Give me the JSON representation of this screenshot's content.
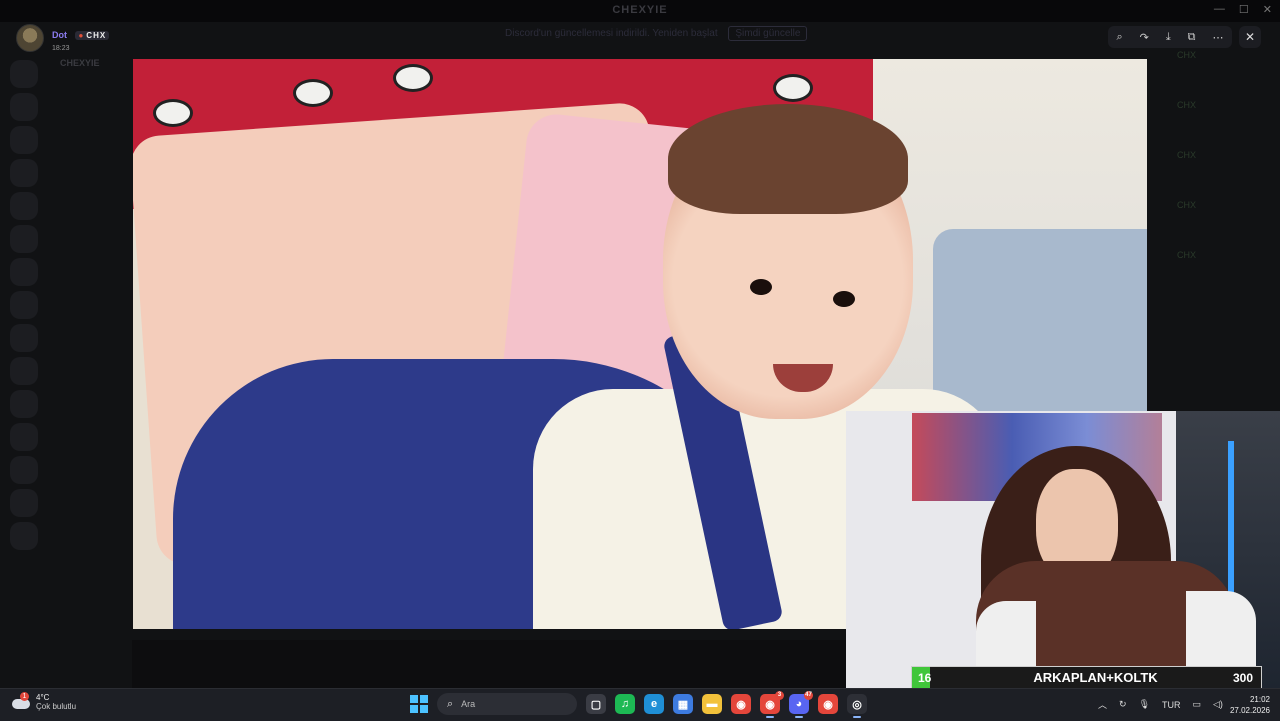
{
  "background_app": {
    "title": "CHEXYIE",
    "notice": "Discord'un güncellemesi indirildi. Yeniden başlat",
    "notice_button": "Şimdi güncelle",
    "server_name": "CHEXYIE",
    "right_tags": [
      "CHX",
      "CHX",
      "CHX",
      "CHX",
      "CHX"
    ]
  },
  "overlay": {
    "username": "Dot",
    "tag": "CHX",
    "time": "18:23",
    "tools": [
      "zoom-icon",
      "forward-icon",
      "download-icon",
      "open-external-icon",
      "more-icon"
    ]
  },
  "stream_goal": {
    "current": "16",
    "label": "ARKAPLAN+KOLTK",
    "max": "300",
    "progress": 0.053,
    "fill_color": "#40c63a"
  },
  "taskbar": {
    "weather_temp": "4°C",
    "weather_desc": "Çok bulutlu",
    "weather_badge": "1",
    "search_placeholder": "Ara",
    "apps": [
      {
        "name": "task-view",
        "glyph": "▢",
        "color": "#3a3c44",
        "active": false
      },
      {
        "name": "spotify",
        "glyph": "♫",
        "color": "#1db954",
        "active": false
      },
      {
        "name": "edge",
        "glyph": "e",
        "color": "#1f8fd6",
        "active": false
      },
      {
        "name": "store",
        "glyph": "▦",
        "color": "#3d7be0",
        "active": false
      },
      {
        "name": "file-explorer",
        "glyph": "▬",
        "color": "#f2c13b",
        "active": false
      },
      {
        "name": "chrome",
        "glyph": "◉",
        "color": "#e4463b",
        "active": false
      },
      {
        "name": "chrome-2",
        "glyph": "◉",
        "color": "#e4463b",
        "active": true,
        "badge": "3"
      },
      {
        "name": "discord",
        "glyph": "◕",
        "color": "#5865f2",
        "active": true,
        "badge": "47"
      },
      {
        "name": "chrome-3",
        "glyph": "◉",
        "color": "#e4463b",
        "active": false
      },
      {
        "name": "obs",
        "glyph": "◎",
        "color": "#2d2f36",
        "active": true
      }
    ],
    "lang": "TUR",
    "time": "21:02",
    "date": "27.02.2026"
  }
}
